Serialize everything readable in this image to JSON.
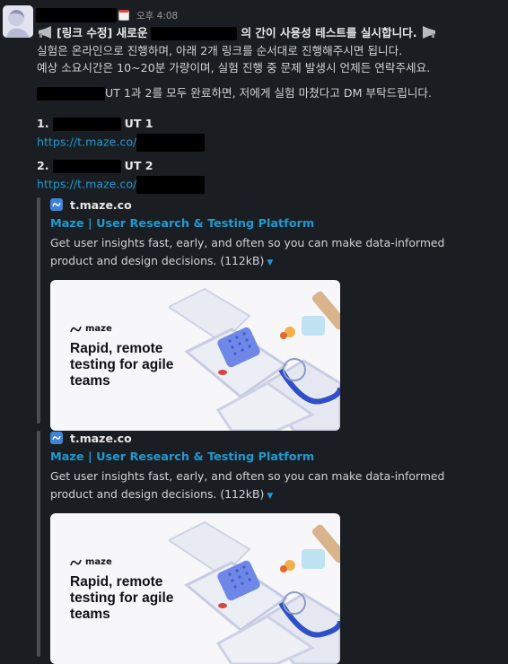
{
  "message": {
    "timestamp": "오후 4:08",
    "line1_prefix": "[링크 수정] 새로운",
    "line1_suffix": "의 간이 사용성 테스트를 실시합니다.",
    "line2": "실험은 온라인으로 진행하며, 아래 2개 링크를 순서대로 진행해주시면 됩니다.",
    "line3": "예상 소요시간은 10~20분 가량이며, 실험 진행 중 문제 발생시 언제든 연락주세요.",
    "line4_suffix": "UT 1과 2를 모두 완료하면, 저에게 실험 마쳤다고 DM 부탁드립니다.",
    "items": [
      {
        "number": "1.",
        "label": "UT 1",
        "url": "https://t.maze.co/"
      },
      {
        "number": "2.",
        "label": "UT 2",
        "url": "https://t.maze.co/"
      }
    ]
  },
  "unfurls": [
    {
      "site": "t.maze.co",
      "title": "Maze | User Research & Testing Platform",
      "description": "Get user insights fast, early, and often so you can make data-informed product and design decisions.",
      "size": "(112kB)",
      "card_brand": "maze",
      "card_headline": "Rapid, remote\ntesting for agile\nteams"
    },
    {
      "site": "t.maze.co",
      "title": "Maze | User Research & Testing Platform",
      "description": "Get user insights fast, early, and often so you can make data-informed product and design decisions.",
      "size": "(112kB)",
      "card_brand": "maze",
      "card_headline": "Rapid, remote\ntesting for agile\nteams"
    }
  ]
}
